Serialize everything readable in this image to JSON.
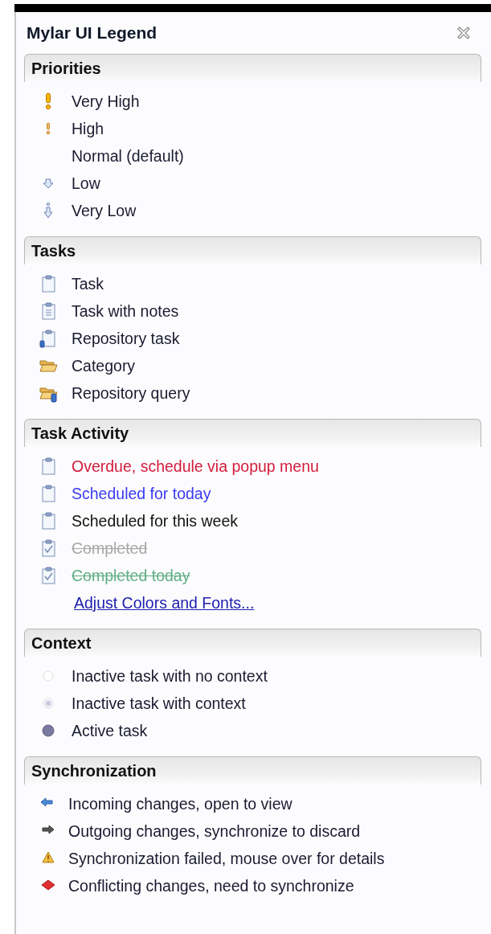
{
  "panel": {
    "title": "Mylar UI Legend"
  },
  "sections": [
    {
      "title": "Priorities",
      "items": [
        {
          "kind": "priority-very-high",
          "label": "Very High"
        },
        {
          "kind": "priority-high",
          "label": "High"
        },
        {
          "kind": "plain",
          "label": "Normal (default)"
        },
        {
          "kind": "priority-low",
          "label": "Low"
        },
        {
          "kind": "priority-very-low",
          "label": "Very Low"
        }
      ]
    },
    {
      "title": "Tasks",
      "items": [
        {
          "kind": "task",
          "label": "Task"
        },
        {
          "kind": "task-notes",
          "label": "Task with notes"
        },
        {
          "kind": "task-repo",
          "label": "Repository task"
        },
        {
          "kind": "folder",
          "label": "Category"
        },
        {
          "kind": "folder-repo",
          "label": "Repository query"
        }
      ]
    },
    {
      "title": "Task Activity",
      "items": [
        {
          "kind": "task",
          "label": "Overdue, schedule via popup menu",
          "color": "#d41c3c",
          "completed": false
        },
        {
          "kind": "task",
          "label": "Scheduled for today",
          "color": "#3a3af2",
          "completed": false
        },
        {
          "kind": "task",
          "label": "Scheduled for this week",
          "color": "#111111",
          "completed": false
        },
        {
          "kind": "task-done",
          "label": "Completed",
          "color": "#a8a8a8",
          "completed": true
        },
        {
          "kind": "task-done",
          "label": "Completed today",
          "color": "#5fae86",
          "completed": true
        },
        {
          "kind": "link",
          "label": "Adjust Colors and Fonts..."
        }
      ]
    },
    {
      "title": "Context",
      "items": [
        {
          "kind": "context-none",
          "label": "Inactive task with no context"
        },
        {
          "kind": "context-inactive",
          "label": "Inactive task with context"
        },
        {
          "kind": "context-active",
          "label": "Active task"
        }
      ]
    },
    {
      "title": "Synchronization",
      "items": [
        {
          "kind": "incoming",
          "label": "Incoming changes, open to view"
        },
        {
          "kind": "outgoing",
          "label": "Outgoing changes, synchronize to discard"
        },
        {
          "kind": "failed",
          "label": "Synchronization failed, mouse over for details"
        },
        {
          "kind": "conflict",
          "label": "Conflicting changes, need to synchronize"
        }
      ]
    }
  ]
}
